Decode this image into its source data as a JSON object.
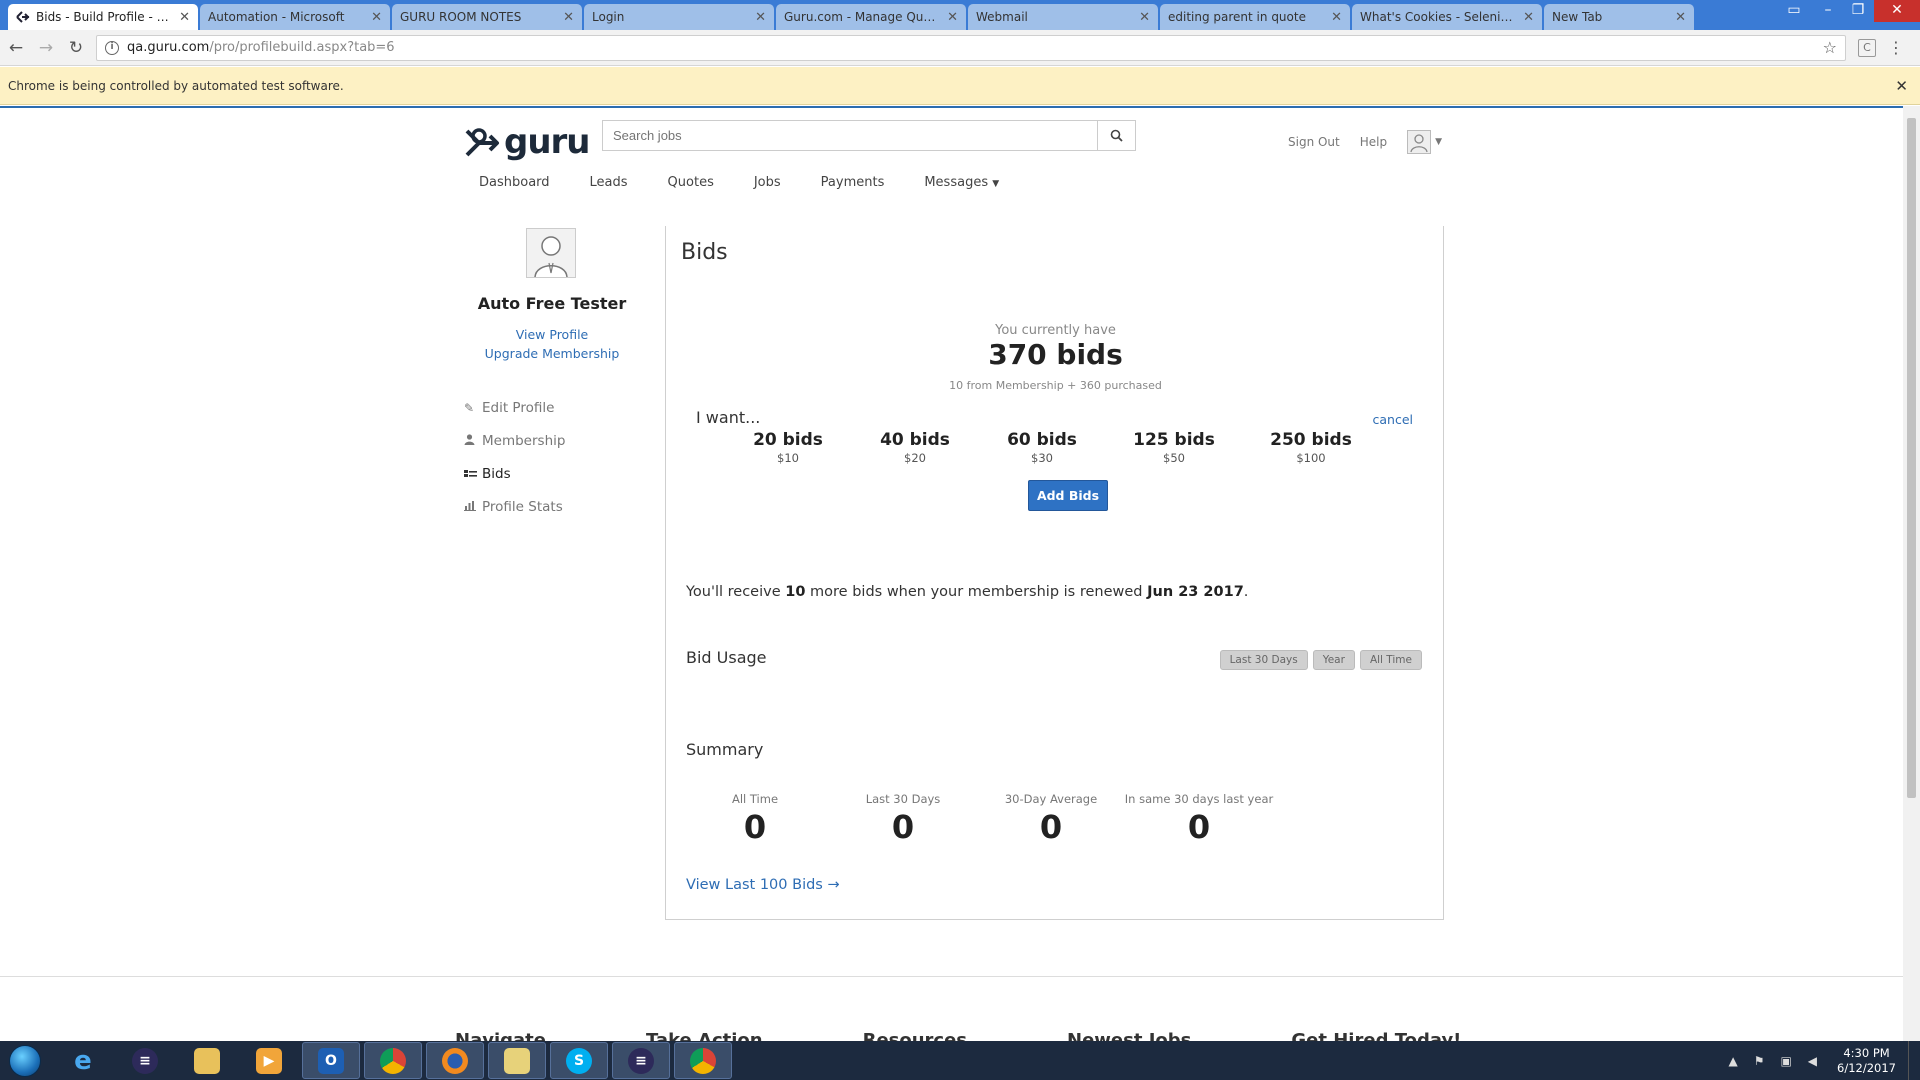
{
  "browser": {
    "tabs": [
      {
        "title": "Bids - Build Profile - Free",
        "active": true
      },
      {
        "title": "Automation - Microsoft",
        "active": false
      },
      {
        "title": "GURU ROOM NOTES",
        "active": false
      },
      {
        "title": "Login",
        "active": false
      },
      {
        "title": "Guru.com - Manage Quotes",
        "active": false
      },
      {
        "title": "Webmail",
        "active": false
      },
      {
        "title": "editing parent in quote",
        "active": false
      },
      {
        "title": "What's Cookies - Selenium",
        "active": false
      },
      {
        "title": "New Tab",
        "active": false
      }
    ],
    "url_host": "qa.guru.com",
    "url_path": "/pro/profilebuild.aspx?tab=6",
    "infobar_text": "Chrome is being controlled by automated test software."
  },
  "header": {
    "logo_text": "guru",
    "search_placeholder": "Search jobs",
    "sign_out": "Sign Out",
    "help": "Help"
  },
  "nav": [
    {
      "label": "Dashboard"
    },
    {
      "label": "Leads"
    },
    {
      "label": "Quotes"
    },
    {
      "label": "Jobs"
    },
    {
      "label": "Payments"
    },
    {
      "label": "Messages"
    }
  ],
  "sidebar": {
    "name": "Auto Free Tester",
    "view_profile": "View Profile",
    "upgrade": "Upgrade Membership",
    "menu": [
      {
        "label": "Edit Profile",
        "icon": "pencil-icon"
      },
      {
        "label": "Membership",
        "icon": "person-icon"
      },
      {
        "label": "Bids",
        "icon": "bids-icon"
      },
      {
        "label": "Profile Stats",
        "icon": "bar-chart-icon"
      }
    ]
  },
  "bids": {
    "title": "Bids",
    "have_label": "You currently have",
    "have_count": "370 bids",
    "have_detail": "10 from Membership + 360 purchased",
    "i_want": "I want...",
    "cancel": "cancel",
    "packages": [
      {
        "bids": "20 bids",
        "price": "$10"
      },
      {
        "bids": "40 bids",
        "price": "$20"
      },
      {
        "bids": "60 bids",
        "price": "$30"
      },
      {
        "bids": "125 bids",
        "price": "$50"
      },
      {
        "bids": "250 bids",
        "price": "$100"
      }
    ],
    "add_button": "Add Bids",
    "renew_prefix": "You'll receive ",
    "renew_count": "10",
    "renew_middle": " more bids when your membership is renewed ",
    "renew_date": "Jun 23 2017",
    "renew_suffix": ".",
    "usage_title": "Bid Usage",
    "usage_filters": [
      "Last 30 Days",
      "Year",
      "All Time"
    ],
    "summary_title": "Summary",
    "stats": [
      {
        "label": "All Time",
        "value": "0"
      },
      {
        "label": "Last 30 Days",
        "value": "0"
      },
      {
        "label": "30-Day Average",
        "value": "0"
      },
      {
        "label": "In same 30 days last year",
        "value": "0"
      }
    ],
    "view_last": "View Last 100 Bids →"
  },
  "footer": {
    "headings": [
      "Navigate",
      "Take Action",
      "Resources",
      "Newest Jobs",
      "Get Hired Today!"
    ]
  },
  "taskbar": {
    "time": "4:30 PM",
    "date": "6/12/2017"
  },
  "colors": {
    "accent_blue": "#2e72c4",
    "link_blue": "#2e6db4",
    "infobar_bg": "#fdf1c4",
    "tab_strip": "#3a7bd5"
  }
}
